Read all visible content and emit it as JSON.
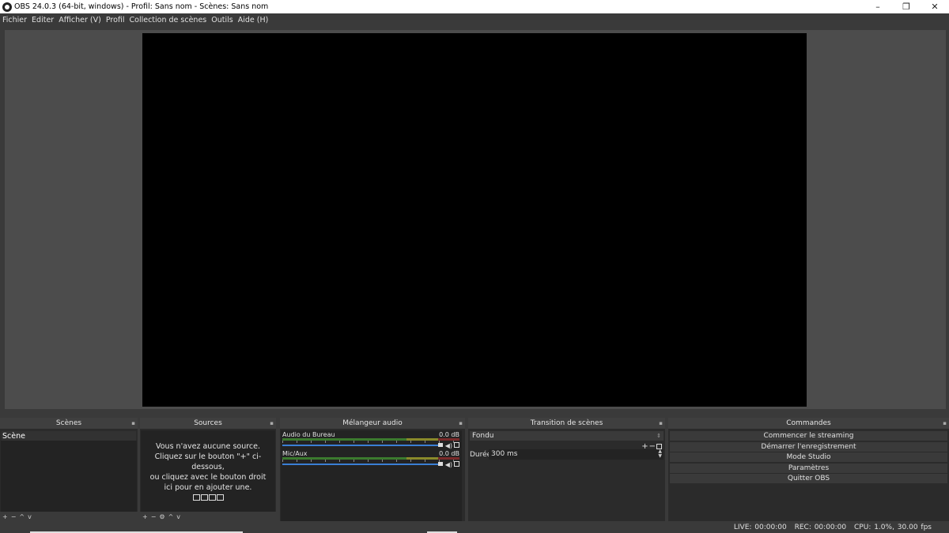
{
  "window": {
    "title": "OBS 24.0.3 (64-bit, windows) - Profil: Sans nom - Scènes: Sans nom",
    "minimize": "–",
    "restore": "❐",
    "close": "✕"
  },
  "menu": [
    "Fichier",
    "Editer",
    "Afficher (V)",
    "Profil",
    "Collection de scènes",
    "Outils",
    "Aide (H)"
  ],
  "docks": {
    "scenes": {
      "title": "Scènes",
      "items": [
        "Scène"
      ],
      "toolbar": [
        "+",
        "−",
        "^",
        "v"
      ]
    },
    "sources": {
      "title": "Sources",
      "empty_message": "Vous n'avez aucune source.\nCliquez sur le bouton \"+\" ci-dessous,\nou cliquez avec le bouton droit ici pour en ajouter une.",
      "toolbar": [
        "+",
        "−",
        "⚙",
        "^",
        "v"
      ]
    },
    "mixer": {
      "title": "Mélangeur audio",
      "channels": [
        {
          "name": "Audio du Bureau",
          "level": "0.0 dB"
        },
        {
          "name": "Mic/Aux",
          "level": "0.0 dB"
        }
      ]
    },
    "transition": {
      "title": "Transition de scènes",
      "selected": "Fondu",
      "duration_label": "Durée",
      "duration_value": "300 ms"
    },
    "commands": {
      "title": "Commandes",
      "buttons": [
        "Commencer le streaming",
        "Démarrer l'enregistrement",
        "Mode Studio",
        "Paramètres",
        "Quitter OBS"
      ]
    }
  },
  "status": {
    "live": "LIVE: 00:00:00",
    "rec": "REC: 00:00:00",
    "cpu": "CPU: 1.0%, 30.00 fps"
  },
  "colors": {
    "background": "#3a3a3a",
    "dock_header": "#3f3f3f",
    "list_bg": "#232323",
    "preview_bg": "#4c4c4c",
    "fader": "#3a7fd5"
  }
}
